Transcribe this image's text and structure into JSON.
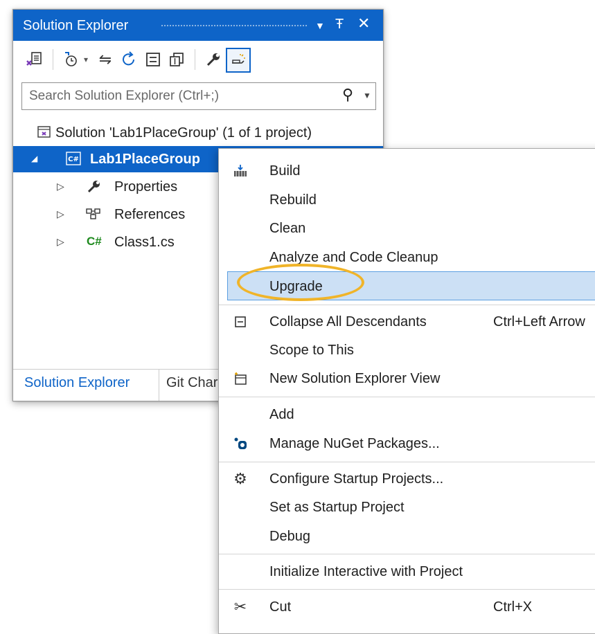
{
  "panel": {
    "title": "Solution Explorer",
    "search_placeholder": "Search Solution Explorer (Ctrl+;)",
    "tree": {
      "solution": "Solution 'Lab1PlaceGroup' (1 of 1 project)",
      "project": "Lab1PlaceGroup",
      "items": [
        "Properties",
        "References",
        "Class1.cs"
      ]
    },
    "tabs": [
      "Solution Explorer",
      "Git Char"
    ]
  },
  "context_menu": {
    "items": [
      {
        "label": "Build",
        "icon": "build-icon"
      },
      {
        "label": "Rebuild"
      },
      {
        "label": "Clean"
      },
      {
        "label": "Analyze and Code Cleanup"
      },
      {
        "label": "Upgrade",
        "highlighted": true
      },
      {
        "label": "Collapse All Descendants",
        "shortcut": "Ctrl+Left Arrow",
        "icon": "collapse-icon"
      },
      {
        "label": "Scope to This"
      },
      {
        "label": "New Solution Explorer View",
        "icon": "new-view-icon"
      },
      {
        "label": "Add"
      },
      {
        "label": "Manage NuGet Packages...",
        "icon": "nuget-icon"
      },
      {
        "label": "Configure Startup Projects...",
        "icon": "gear-icon"
      },
      {
        "label": "Set as Startup Project"
      },
      {
        "label": "Debug"
      },
      {
        "label": "Initialize Interactive with Project"
      },
      {
        "label": "Cut",
        "shortcut": "Ctrl+X",
        "icon": "scissors-icon"
      }
    ]
  },
  "colors": {
    "accent": "#0e64c8",
    "highlight": "#cce0f5",
    "callout": "#f0b429"
  }
}
